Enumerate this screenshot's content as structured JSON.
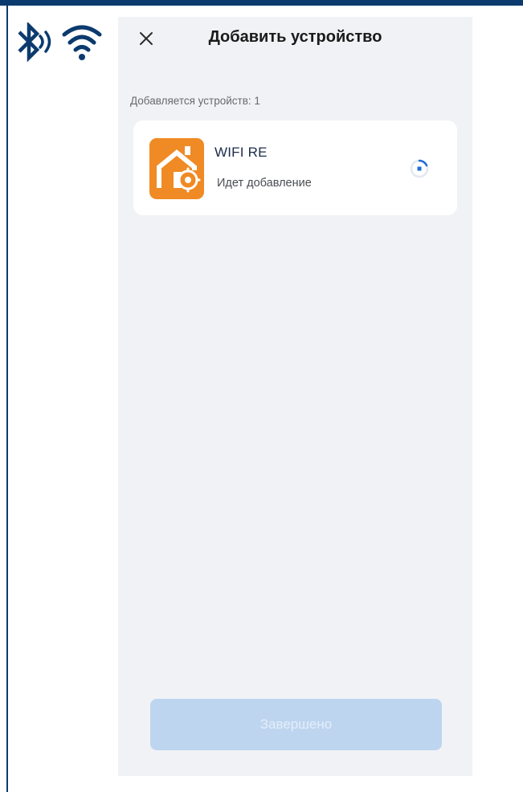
{
  "header": {
    "title": "Добавить устройство"
  },
  "summary": {
    "count_label": "Добавляется устройств: 1"
  },
  "device": {
    "name": "WIFI RE",
    "status": "Идет добавление",
    "icon_color": "#f08a24"
  },
  "footer": {
    "done_label": "Завершено"
  },
  "colors": {
    "frame": "#0b3a6e",
    "background": "#f1f2f5",
    "card": "#ffffff",
    "button_disabled": "#bed5ef",
    "spinner": "#1f6fd6"
  },
  "icons": [
    "bluetooth-icon",
    "sound-waves-icon",
    "wifi-icon",
    "close-icon",
    "device-icon",
    "loading-spinner-icon"
  ]
}
